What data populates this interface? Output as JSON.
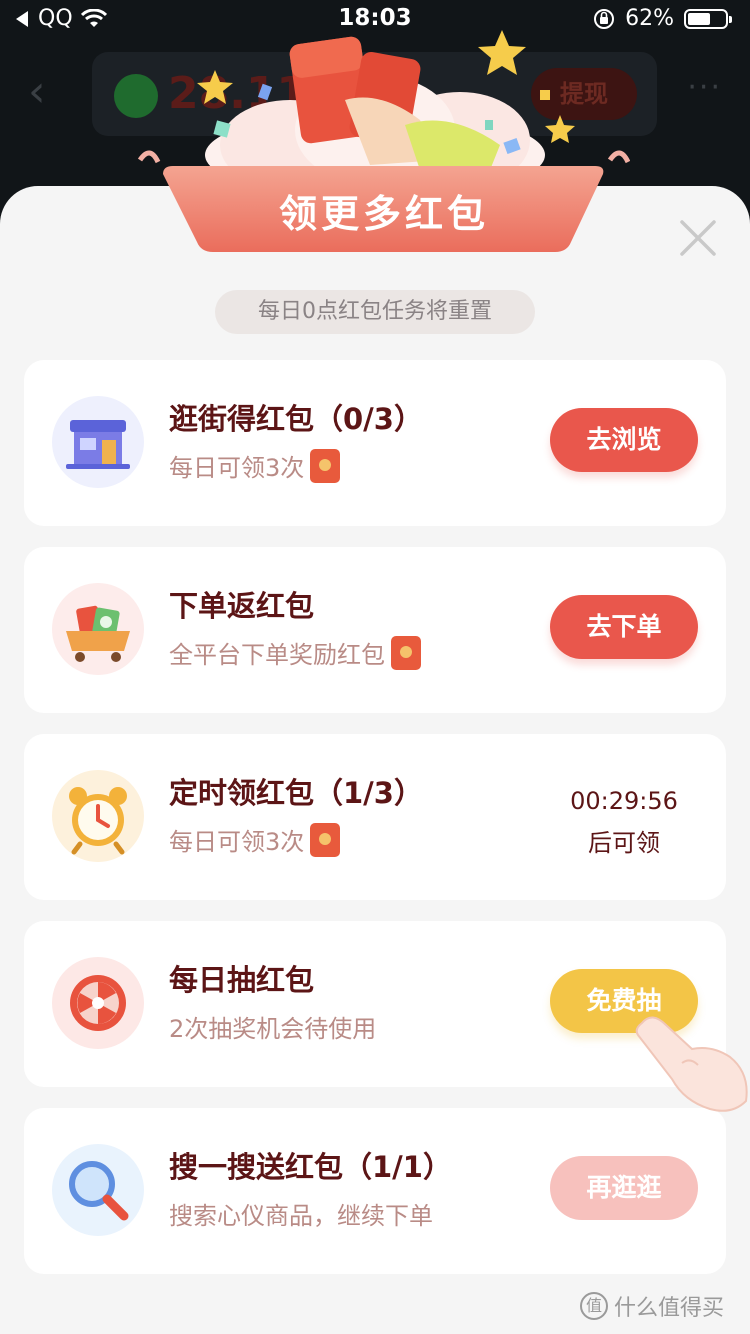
{
  "status_bar": {
    "back_app": "QQ",
    "time": "18:03",
    "battery": "62%",
    "battery_level": 0.62
  },
  "background": {
    "balance": "28.11",
    "withdraw_label": "提现"
  },
  "modal": {
    "title": "领更多红包",
    "reset_note": "每日0点红包任务将重置",
    "tasks": [
      {
        "title": "逛街得红包（0/3）",
        "subtitle": "每日可领3次",
        "button": "去浏览",
        "icon": "store-icon"
      },
      {
        "title": "下单返红包",
        "subtitle": "全平台下单奖励红包",
        "button": "去下单",
        "icon": "cart-icon"
      },
      {
        "title": "定时领红包（1/3）",
        "subtitle": "每日可领3次",
        "countdown": "00:29:56",
        "countdown_note": "后可领",
        "icon": "alarm-clock-icon"
      },
      {
        "title": "每日抽红包",
        "subtitle": "2次抽奖机会待使用",
        "button": "免费抽",
        "icon": "lottery-wheel-icon"
      },
      {
        "title": "搜一搜送红包（1/1）",
        "subtitle": "搜索心仪商品，继续下单",
        "button": "再逛逛",
        "icon": "magnifier-icon"
      }
    ]
  },
  "watermark": "什么值得买",
  "colors": {
    "accent_red": "#e9574c",
    "accent_yellow": "#f3c547",
    "title_dark_red": "#5c1516"
  }
}
